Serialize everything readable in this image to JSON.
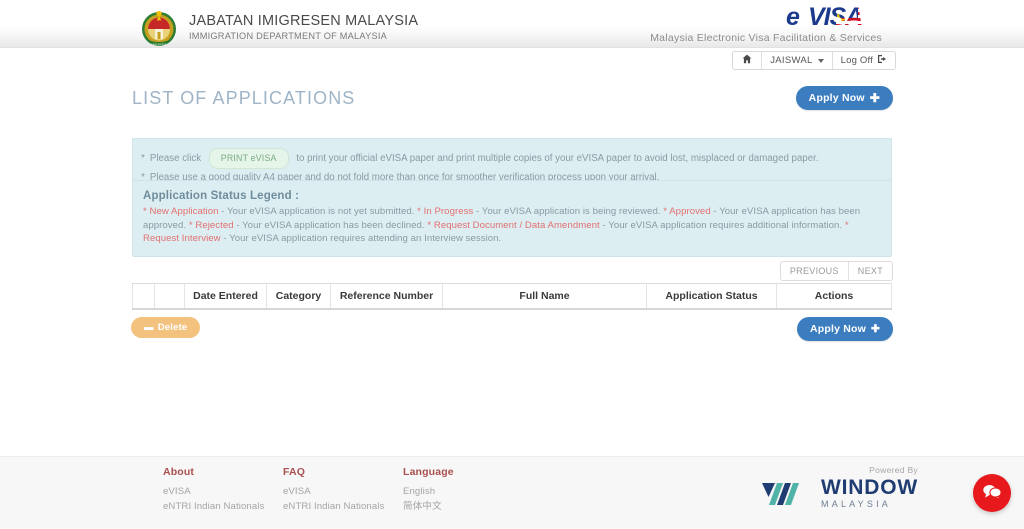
{
  "header": {
    "agency_name_my": "JABATAN IMIGRESEN MALAYSIA",
    "agency_name_en": "IMMIGRATION DEPARTMENT OF MALAYSIA",
    "logo_text": "eVISA",
    "tagline": "Malaysia Electronic Visa Facilitation & Services",
    "crest_icon": "malaysia-immigration-crest-icon"
  },
  "userbar": {
    "home_icon": "home-icon",
    "username": "JAISWAL",
    "caret_icon": "chevron-down-icon",
    "logoff_label": "Log Off",
    "logoff_icon": "logout-icon"
  },
  "page": {
    "title": "LIST OF APPLICATIONS",
    "apply_label": "Apply Now",
    "apply_icon": "plus-icon"
  },
  "notes": {
    "star": "*",
    "line1_pre": "Please click",
    "print_pill": "PRINT eVISA",
    "line1_post": "to print your official eVISA paper and print multiple copies of your eVISA paper to avoid lost, misplaced or damaged paper.",
    "line2": "Please use a good quality A4 paper and do not fold more than once for smoother verification process upon your arrival."
  },
  "legend": {
    "title": "Application Status Legend :",
    "items": [
      {
        "status": "New Application",
        "desc": " - Your eVISA application is not yet submitted. "
      },
      {
        "status": "In Progress",
        "desc": " - Your eVISA application is being reviewed. "
      },
      {
        "status": "Approved",
        "desc": " - Your eVISA application has been approved. "
      },
      {
        "status": "Rejected",
        "desc": " - Your eVISA application has been declined. "
      },
      {
        "status": "Request Document / Data Amendment",
        "desc": " - Your eVISA application requires additional information. "
      },
      {
        "status": "Request Interview",
        "desc": "  - Your eVISA application requires attending an Interview session."
      }
    ],
    "marker": "*"
  },
  "pagination": {
    "previous_label": "PREVIOUS",
    "next_label": "NEXT"
  },
  "table": {
    "columns": [
      {
        "key": "checkbox",
        "label": ""
      },
      {
        "key": "icon",
        "label": ""
      },
      {
        "key": "date_entered",
        "label": "Date Entered"
      },
      {
        "key": "category",
        "label": "Category"
      },
      {
        "key": "reference_number",
        "label": "Reference Number"
      },
      {
        "key": "full_name",
        "label": "Full Name"
      },
      {
        "key": "application_status",
        "label": "Application Status"
      },
      {
        "key": "actions",
        "label": "Actions"
      }
    ],
    "rows": []
  },
  "actions": {
    "delete_label": "Delete",
    "delete_icon": "minus-icon",
    "apply_label": "Apply Now",
    "apply_icon": "plus-icon"
  },
  "footer": {
    "columns": [
      {
        "heading": "About",
        "links": [
          "eVISA",
          "eNTRI Indian Nationals"
        ]
      },
      {
        "heading": "FAQ",
        "links": [
          "eVISA",
          "eNTRI Indian Nationals"
        ]
      },
      {
        "heading": "Language",
        "links": [
          "English",
          "简体中文"
        ]
      }
    ],
    "powered_by_label": "Powered By",
    "partner_name": "WINDOW",
    "partner_sub": "MALAYSIA",
    "partner_logo_icon": "window-malaysia-logo-icon",
    "chat_icon": "chat-bubble-icon"
  },
  "colors": {
    "accent_blue": "#3b7dbf",
    "panel_bg": "#ddeef3",
    "status_red": "#e2706f",
    "delete_orange": "#f3c27f",
    "chat_red": "#e8191c",
    "footer_heading": "#a8504f",
    "title_blue": "#9fb4c6"
  }
}
